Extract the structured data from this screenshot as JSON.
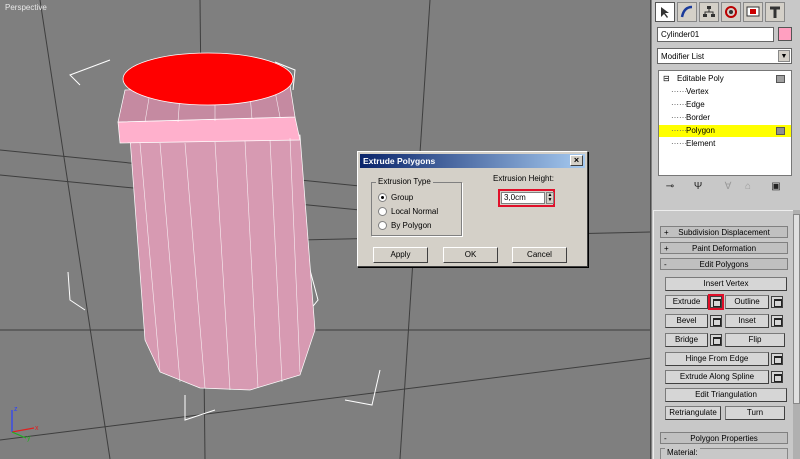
{
  "viewport": {
    "label": "Perspective"
  },
  "object": {
    "name": "Cylinder01",
    "color": "#ff9fc0"
  },
  "modifier_list": {
    "label": "Modifier List"
  },
  "stack": {
    "items": [
      {
        "label": "Editable Poly"
      },
      {
        "label": "Vertex"
      },
      {
        "label": "Edge"
      },
      {
        "label": "Border"
      },
      {
        "label": "Polygon",
        "selected": true
      },
      {
        "label": "Element"
      }
    ]
  },
  "rollouts": {
    "subdivision_displacement": "Subdivision Displacement",
    "paint_deformation": "Paint Deformation",
    "edit_polygons": "Edit Polygons",
    "polygon_properties": "Polygon Properties",
    "plus": "+",
    "minus": "-"
  },
  "edit_polygons": {
    "insert_vertex": "Insert Vertex",
    "extrude": "Extrude",
    "outline": "Outline",
    "bevel": "Bevel",
    "inset": "Inset",
    "bridge": "Bridge",
    "flip": "Flip",
    "hinge_from_edge": "Hinge From Edge",
    "extrude_along_spline": "Extrude Along Spline",
    "edit_triangulation": "Edit Triangulation",
    "retriangulate": "Retriangulate",
    "turn": "Turn"
  },
  "polygon_properties": {
    "material_label": "Material:"
  },
  "dialog": {
    "title": "Extrude Polygons",
    "close": "×",
    "group_label": "Extrusion Type",
    "options": [
      {
        "label": "Group",
        "checked": true
      },
      {
        "label": "Local Normal",
        "checked": false
      },
      {
        "label": "By Polygon",
        "checked": false
      }
    ],
    "height_label": "Extrusion Height:",
    "height_value": "3,0cm",
    "apply": "Apply",
    "ok": "OK",
    "cancel": "Cancel"
  },
  "axis": {
    "x": "x",
    "y": "y",
    "z": "z"
  },
  "colors": {
    "selected_face": "#ff0000",
    "cylinder": "#d79ab2",
    "ring": "#ffb0cc",
    "highlight": "#e0102a",
    "stack_selection": "#ffff00"
  }
}
